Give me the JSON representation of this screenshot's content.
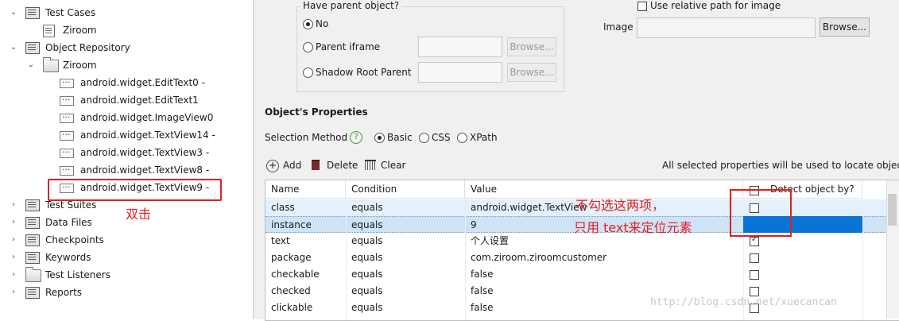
{
  "tree": {
    "test_cases": "Test Cases",
    "test_cases_child": "Ziroom",
    "object_repository": "Object Repository",
    "repo_folder": "Ziroom",
    "objects": [
      "android.widget.EditText0 -",
      "android.widget.EditText1",
      "android.widget.ImageView0",
      "android.widget.TextView14 -",
      "android.widget.TextView3 -",
      "android.widget.TextView8 -",
      "android.widget.TextView9 -"
    ],
    "test_suites": "Test Suites",
    "data_files": "Data Files",
    "checkpoints": "Checkpoints",
    "keywords": "Keywords",
    "test_listeners": "Test Listeners",
    "reports": "Reports",
    "annotation": "双击"
  },
  "parent": {
    "legend": "Have parent object?",
    "no": "No",
    "iframe": "Parent iframe",
    "shadow": "Shadow Root Parent",
    "browse": "Browse..."
  },
  "image": {
    "relative_path": "Use relative path for image",
    "label": "Image",
    "browse": "Browse..."
  },
  "props": {
    "title": "Object's Properties",
    "selection_method": "Selection Method",
    "help": "?",
    "basic": "Basic",
    "css": "CSS",
    "xpath": "XPath",
    "add": "Add",
    "delete": "Delete",
    "clear": "Clear",
    "note": "All selected properties will be used to locate object"
  },
  "table": {
    "headers": [
      "Name",
      "Condition",
      "Value",
      "Detect object by?"
    ],
    "rows": [
      {
        "name": "class",
        "condition": "equals",
        "value": "android.widget.TextView",
        "checked": false
      },
      {
        "name": "instance",
        "condition": "equals",
        "value": "9",
        "checked": false
      },
      {
        "name": "text",
        "condition": "equals",
        "value": "个人设置",
        "checked": true
      },
      {
        "name": "package",
        "condition": "equals",
        "value": "com.ziroom.ziroomcustomer",
        "checked": false
      },
      {
        "name": "checkable",
        "condition": "equals",
        "value": "false",
        "checked": false
      },
      {
        "name": "checked",
        "condition": "equals",
        "value": "false",
        "checked": false
      },
      {
        "name": "clickable",
        "condition": "equals",
        "value": "false",
        "checked": false
      }
    ]
  },
  "annotations": {
    "line1": "不勾选这两项，",
    "line2": "只用 text来定位元素"
  },
  "watermark": "http://blog.csdn.net/xuecancan",
  "colors": {
    "annotation": "#e02020",
    "selection": "#0a74d6"
  }
}
